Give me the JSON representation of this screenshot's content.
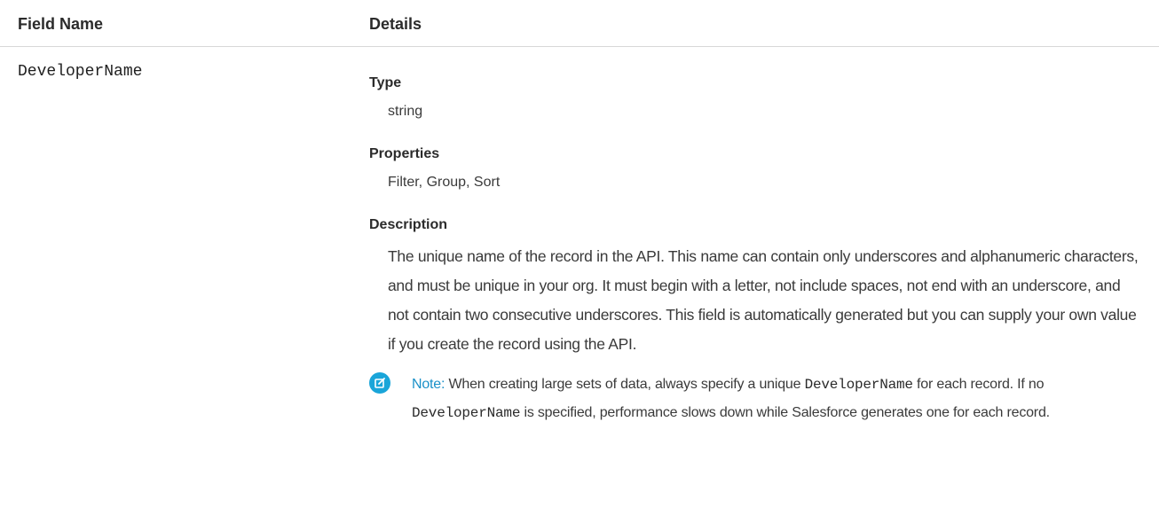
{
  "table": {
    "headers": {
      "field_name": "Field Name",
      "details": "Details"
    },
    "row": {
      "field_name": "DeveloperName",
      "type_label": "Type",
      "type_value": "string",
      "properties_label": "Properties",
      "properties_value": "Filter, Group, Sort",
      "description_label": "Description",
      "description_text": "The unique name of the record in the API. This name can contain only underscores and alphanumeric characters, and must be unique in your org. It must begin with a letter, not include spaces, not end with an underscore, and not contain two consecutive underscores. This field is automatically generated but you can supply your own value if you create the record using the API.",
      "note": {
        "icon": "edit-note-icon",
        "accent": "#1aa5d9",
        "label": "Note:",
        "part1": " When creating large sets of data, always specify a unique ",
        "code1": "DeveloperName",
        "part2": " for each record. If no ",
        "code2": "DeveloperName",
        "part3": " is specified, performance slows down while Salesforce generates one for each record."
      }
    }
  }
}
